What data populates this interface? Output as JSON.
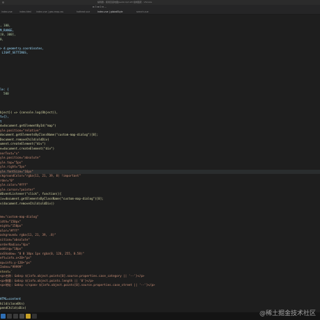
{
  "window": {
    "title": "编辑器 - 使用百度地图JavaScript API 绘制图层 - VSCode"
  },
  "editor_tabs": [
    {
      "label": "index.vue"
    },
    {
      "label": "index.html"
    },
    {
      "label": "index.vue | geo-map.css"
    },
    {
      "label": "hotheat.vue"
    },
    {
      "label": "index.vue | globalStyle"
    },
    {
      "label": "search.vue"
    }
  ],
  "breadcrumb": "⊞ 3 ⊞ 0 ⊟ ...",
  "code_lines": [
    {
      "text": "",
      "cls": ""
    },
    {
      "text": "",
      "cls": ""
    },
    {
      "text": ", 100,",
      "cls": "n"
    },
    {
      "text": "M_RANGE,",
      "cls": "v"
    },
    {
      "text": "[0, 300],",
      "cls": "n"
    },
    {
      "text": "0,",
      "cls": "n"
    },
    {
      "text": "",
      "cls": ""
    },
    {
      "text": "> d.geometry.coordinates,",
      "cls": "v"
    },
    {
      "text": " LIGHT_SETTINGS,",
      "cls": "v"
    },
    {
      "text": "",
      "cls": ""
    },
    {
      "text": "",
      "cls": ""
    },
    {
      "text": "",
      "cls": ""
    },
    {
      "text": "",
      "cls": ""
    },
    {
      "text": "",
      "cls": ""
    },
    {
      "text": "",
      "cls": ""
    },
    {
      "text": "",
      "cls": ""
    },
    {
      "text": "le: {",
      "cls": "v"
    },
    {
      "text": "  500",
      "cls": "n"
    },
    {
      "text": "",
      "cls": ""
    },
    {
      "text": "",
      "cls": ""
    },
    {
      "text": "",
      "cls": ""
    },
    {
      "text": "bject}) => {console.log(Object)},",
      "cls": "f"
    },
    {
      "text": "t={},",
      "cls": "v"
    },
    {
      "text": "t",
      "cls": "v"
    },
    {
      "text": "d=document.getElementById(\"map\")",
      "cls": "f"
    },
    {
      "text": "yle.position=\"relative\"",
      "cls": "s"
    },
    {
      "text": "document.getElementsByClassName(\"custom-map-dialog\")[0];",
      "cls": "f"
    },
    {
      "text": "Document.removeChild(oldDiv)",
      "cls": "f"
    },
    {
      "text": "ument.createElement(\"div\")",
      "cls": "f"
    },
    {
      "text": "e=document.createElement(\"div\")",
      "cls": "f"
    },
    {
      "text": "nerText=\"x\"",
      "cls": "s"
    },
    {
      "text": "yle.position=\"absolute\"",
      "cls": "s"
    },
    {
      "text": "yle.top=\"5px\"",
      "cls": "s"
    },
    {
      "text": "yle.right=\"5px\"",
      "cls": "s"
    },
    {
      "text": "yle.fontSize=\"16px\"",
      "cls": "s",
      "cur": true
    },
    {
      "text": "ckgroundColor=\"rgba(11, 21, 39, 0) !important\"",
      "cls": "s"
    },
    {
      "text": "rder=\"0\"",
      "cls": "s"
    },
    {
      "text": "yle.color=\"#fff\"",
      "cls": "s"
    },
    {
      "text": "yle.cursor=\"pointer\"",
      "cls": "s"
    },
    {
      "text": "dEventListener(\"click\", function(){",
      "cls": "f"
    },
    {
      "text": "iv=document.getElementsByClassName(\"custom-map-dialog\")[0];",
      "cls": "f"
    },
    {
      "text": "v(document.removeChild(oldDiv))",
      "cls": "f"
    },
    {
      "text": "",
      "cls": ""
    },
    {
      "text": "",
      "cls": ""
    },
    {
      "text": "me=\"custom-map-dialog\"",
      "cls": "s"
    },
    {
      "text": "idth=\"150px\"",
      "cls": "s"
    },
    {
      "text": "eight=\"150px\"",
      "cls": "s"
    },
    {
      "text": "olor=\"#fff\"",
      "cls": "s"
    },
    {
      "text": "ackground= rgba(11, 21, 39, .8)\"",
      "cls": "s"
    },
    {
      "text": "sition=\"absolute\"",
      "cls": "s"
    },
    {
      "text": "orderRadius=\"4px\"",
      "cls": "s"
    },
    {
      "text": "adding=\"10px\"",
      "cls": "s"
    },
    {
      "text": "oxShadow= \"0 0 10px 1px rgba(0, 126, 255, 0.58)\"",
      "cls": "s"
    },
    {
      "text": "eft=info.x+20+\"px\"",
      "cls": "s"
    },
    {
      "text": "op=info.y-120+\"px\"",
      "cls": "s"
    },
    {
      "text": "Index=\"99999\"",
      "cls": "s"
    },
    {
      "text": "ntent=`",
      "cls": "y"
    },
    {
      "text": "<p>名称: &nbsp ${info.object.points[0].source.properties.case_category || '--'}</p>",
      "cls": "s"
    },
    {
      "text": "<p>数量: &nbsp ${info.object.points.length || '0'}</p>",
      "cls": "s"
    },
    {
      "text": "<p>地址: &nbsp </span> ${info.object.points[0].source.properties.case_street || '--'}</p>",
      "cls": "s"
    },
    {
      "text": "",
      "cls": ""
    },
    {
      "text": "",
      "cls": ""
    },
    {
      "text": "HTML=content",
      "cls": "v"
    },
    {
      "text": "hild(closeBtn)",
      "cls": "f"
    },
    {
      "text": "pendChild(oDiv)",
      "cls": "f"
    }
  ],
  "status_icons": [
    {
      "icon": "windows-logo-icon",
      "color": "#2f6fb5"
    },
    {
      "icon": "search-icon",
      "color": "#3a3a3a"
    },
    {
      "icon": "taskview-icon",
      "color": "#3a3a3a"
    },
    {
      "icon": "chrome-icon",
      "color": "#4a4a4a"
    },
    {
      "icon": "explorer-icon",
      "color": "#c9a227"
    },
    {
      "icon": "terminal-icon",
      "color": "#333333"
    }
  ],
  "watermark": "@稀土掘金技术社区"
}
